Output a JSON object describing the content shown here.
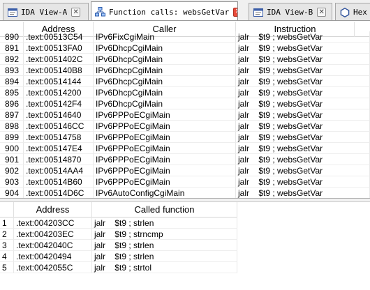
{
  "tabs": [
    {
      "label": "IDA View-A",
      "icon": "ida-view-icon",
      "active": false,
      "closable": true
    },
    {
      "label": "Function calls: websGetVar",
      "icon": "function-calls-icon",
      "active": true,
      "closable": true
    },
    {
      "label": "IDA View-B",
      "icon": "ida-view-icon",
      "active": false,
      "closable": true
    },
    {
      "label": "Hex",
      "icon": "hex-view-icon",
      "active": false,
      "closable": false
    }
  ],
  "callers_table": {
    "columns": [
      "Address",
      "Caller",
      "Instruction"
    ],
    "rows": [
      {
        "num": "890",
        "address": ".text:00513C54",
        "caller": "IPv6FixCgiMain",
        "instruction": "jalr    $t9 ; websGetVar"
      },
      {
        "num": "891",
        "address": ".text:00513FA0",
        "caller": "IPv6DhcpCgiMain",
        "instruction": "jalr    $t9 ; websGetVar"
      },
      {
        "num": "892",
        "address": ".text:0051402C",
        "caller": "IPv6DhcpCgiMain",
        "instruction": "jalr    $t9 ; websGetVar"
      },
      {
        "num": "893",
        "address": ".text:005140B8",
        "caller": "IPv6DhcpCgiMain",
        "instruction": "jalr    $t9 ; websGetVar"
      },
      {
        "num": "894",
        "address": ".text:00514144",
        "caller": "IPv6DhcpCgiMain",
        "instruction": "jalr    $t9 ; websGetVar"
      },
      {
        "num": "895",
        "address": ".text:00514200",
        "caller": "IPv6DhcpCgiMain",
        "instruction": "jalr    $t9 ; websGetVar"
      },
      {
        "num": "896",
        "address": ".text:005142F4",
        "caller": "IPv6DhcpCgiMain",
        "instruction": "jalr    $t9 ; websGetVar"
      },
      {
        "num": "897",
        "address": ".text:00514640",
        "caller": "IPv6PPPoECgiMain",
        "instruction": "jalr    $t9 ; websGetVar"
      },
      {
        "num": "898",
        "address": ".text:005146CC",
        "caller": "IPv6PPPoECgiMain",
        "instruction": "jalr    $t9 ; websGetVar"
      },
      {
        "num": "899",
        "address": ".text:00514758",
        "caller": "IPv6PPPoECgiMain",
        "instruction": "jalr    $t9 ; websGetVar"
      },
      {
        "num": "900",
        "address": ".text:005147E4",
        "caller": "IPv6PPPoECgiMain",
        "instruction": "jalr    $t9 ; websGetVar"
      },
      {
        "num": "901",
        "address": ".text:00514870",
        "caller": "IPv6PPPoECgiMain",
        "instruction": "jalr    $t9 ; websGetVar"
      },
      {
        "num": "902",
        "address": ".text:00514AA4",
        "caller": "IPv6PPPoECgiMain",
        "instruction": "jalr    $t9 ; websGetVar"
      },
      {
        "num": "903",
        "address": ".text:00514B60",
        "caller": "IPv6PPPoECgiMain",
        "instruction": "jalr    $t9 ; websGetVar"
      },
      {
        "num": "904",
        "address": ".text:00514D6C",
        "caller": "IPv6AutoConfigCgiMain",
        "instruction": "jalr    $t9 ; websGetVar"
      }
    ]
  },
  "called_table": {
    "columns": [
      "Address",
      "Called function"
    ],
    "rows": [
      {
        "num": "1",
        "address": ".text:004203CC",
        "called": "jalr    $t9 ; strlen"
      },
      {
        "num": "2",
        "address": ".text:004203EC",
        "called": "jalr    $t9 ; strncmp"
      },
      {
        "num": "3",
        "address": ".text:0042040C",
        "called": "jalr    $t9 ; strlen"
      },
      {
        "num": "4",
        "address": ".text:00420494",
        "called": "jalr    $t9 ; strlen"
      },
      {
        "num": "5",
        "address": ".text:0042055C",
        "called": "jalr    $t9 ; strtol"
      }
    ]
  },
  "colors": {
    "active_tab_close": "#e84a3a",
    "tab_bar": "#f0f0f0"
  }
}
